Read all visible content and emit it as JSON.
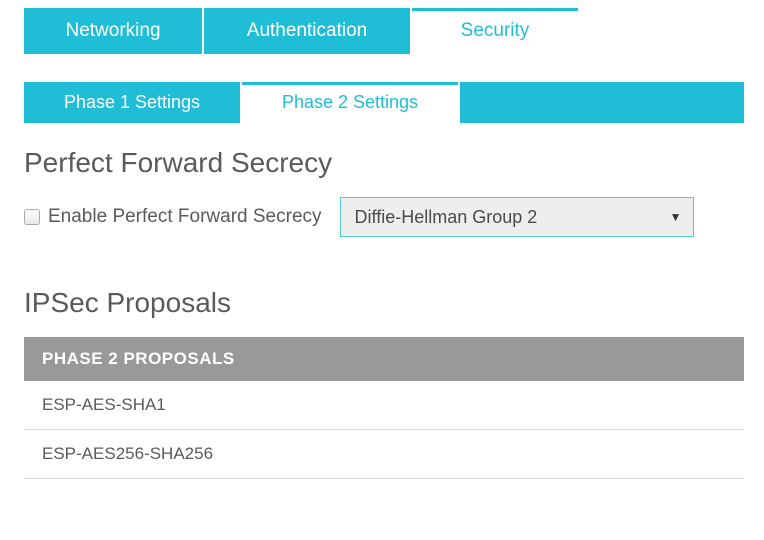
{
  "primaryTabs": {
    "networking": "Networking",
    "authentication": "Authentication",
    "security": "Security"
  },
  "secondaryTabs": {
    "phase1": "Phase 1 Settings",
    "phase2": "Phase 2 Settings"
  },
  "pfs": {
    "heading": "Perfect Forward Secrecy",
    "checkboxLabel": "Enable Perfect Forward Secrecy",
    "selectedGroup": "Diffie-Hellman Group 2"
  },
  "ipsec": {
    "heading": "IPSec Proposals",
    "tableHeader": "PHASE 2 PROPOSALS",
    "rows": [
      "ESP-AES-SHA1",
      "ESP-AES256-SHA256"
    ]
  }
}
